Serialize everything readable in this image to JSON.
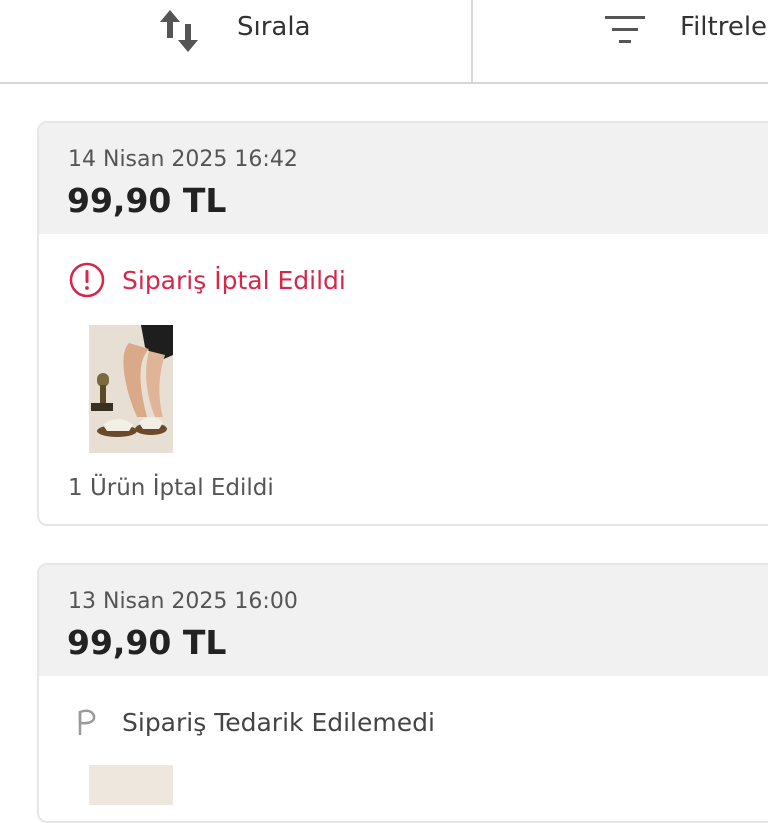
{
  "toolbar": {
    "sort": {
      "label": "Sırala",
      "icon": "sort-arrows-icon"
    },
    "filter": {
      "label": "Filtrele",
      "icon": "filter-lines-icon"
    }
  },
  "orders": [
    {
      "date": "14 Nisan 2025 16:42",
      "price": "99,90 TL",
      "status": {
        "text": "Sipariş İptal Edildi",
        "icon": "alert-circle-icon",
        "color": "#d7264c"
      },
      "summary": "1 Ürün İptal Edildi"
    },
    {
      "date": "13 Nisan 2025 16:00",
      "price": "99,90 TL",
      "status": {
        "text": "Sipariş Tedarik Edilemedi",
        "icon": "flag-icon",
        "color": "#444444"
      }
    }
  ],
  "colors": {
    "accent_red": "#d7264c",
    "card_header_bg": "#f1f1f1",
    "border": "#e6e6e6"
  }
}
